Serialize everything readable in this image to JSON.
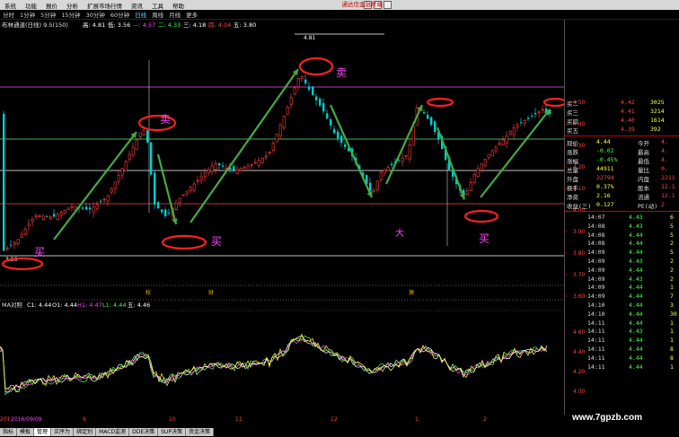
{
  "menubar": {
    "items": [
      "系统",
      "功能",
      "报价",
      "分析",
      "扩展市场行情",
      "资讯",
      "工具",
      "帮助"
    ],
    "brand": "通达信金融终端"
  },
  "periodbar": {
    "items": [
      "分时",
      "1分钟",
      "5分钟",
      "15分钟",
      "30分钟",
      "60分钟",
      "日线",
      "周线",
      "月线",
      "更多"
    ],
    "active": "日线"
  },
  "legend": {
    "main": "布林通道(日线) 9.5(150)",
    "main_vals": [
      {
        "t": "高: 4.81",
        "c": "#ffffff"
      },
      {
        "t": "低: 3.56",
        "c": "#ffffff"
      },
      {
        "t": "—: 4.57",
        "c": "#ff44ff"
      },
      {
        "t": "二: 4.33",
        "c": "#44ff44"
      },
      {
        "t": "三: 4.18",
        "c": "#ffffff"
      },
      {
        "t": "四: 4.04",
        "c": "#ff4444"
      },
      {
        "t": "五: 3.80",
        "c": "#ffffff"
      }
    ],
    "peak_label": "4.81",
    "low_label": "3.56",
    "indicator": "MA对照",
    "ind_vals": [
      {
        "t": "C1: 4.44",
        "c": "#ffffff"
      },
      {
        "t": "O1: 4.44",
        "c": "#ffffff"
      },
      {
        "t": "H1: 4.47",
        "c": "#ff44ff"
      },
      {
        "t": "L1: 4.44",
        "c": "#44ff44"
      },
      {
        "t": "五: 4.46",
        "c": "#ffffff"
      }
    ]
  },
  "annotations": {
    "buy": "买",
    "sell": "卖",
    "markers": [
      "权",
      "财",
      "激"
    ]
  },
  "price_axis": [
    "4.50",
    "4.40",
    "4.30",
    "4.20",
    "4.10",
    "4.00",
    "3.90",
    "3.80",
    "3.70",
    "3.60"
  ],
  "ind_axis": [
    "4.60",
    "4.40",
    "4.20",
    "4.00"
  ],
  "date_axis": [
    "2016/09/09",
    "9",
    "10",
    "11",
    "12",
    "1",
    "2"
  ],
  "date_prefix": "201",
  "quotes": [
    {
      "label": "买二",
      "price": "4.42",
      "vol": "3025"
    },
    {
      "label": "买三",
      "price": "4.41",
      "vol": "3214"
    },
    {
      "label": "买四",
      "price": "4.40",
      "vol": "1614"
    },
    {
      "label": "买五",
      "price": "4.39",
      "vol": "392"
    }
  ],
  "stats": [
    {
      "k": "现价",
      "v": "4.44",
      "k2": "今开",
      "v2": "4."
    },
    {
      "k": "涨跌",
      "v": "-0.02",
      "k2": "最高",
      "v2": "4."
    },
    {
      "k": "涨幅",
      "v": "-0.45%",
      "k2": "最低",
      "v2": "4."
    },
    {
      "k": "总量",
      "v": "44911",
      "k2": "量比",
      "v2": "0."
    },
    {
      "k": "外盘",
      "v": "22794",
      "k2": "内盘",
      "v2": "2211"
    },
    {
      "k": "换手",
      "v": "0.37%",
      "k2": "股本",
      "v2": "12.1"
    },
    {
      "k": "净资",
      "v": "2.16",
      "k2": "流通",
      "v2": "12.1"
    },
    {
      "k": "收益(三)",
      "v": "0.127",
      "k2": "PE(动)",
      "v2": "2"
    }
  ],
  "ticks": [
    {
      "t": "14:07",
      "p": "4.43",
      "v": "6"
    },
    {
      "t": "14:08",
      "p": "4.43",
      "v": "5"
    },
    {
      "t": "14:08",
      "p": "4.44",
      "v": "5"
    },
    {
      "t": "14:08",
      "p": "4.44",
      "v": "2"
    },
    {
      "t": "14:09",
      "p": "4.44",
      "v": "5"
    },
    {
      "t": "14:09",
      "p": "4.43",
      "v": "2"
    },
    {
      "t": "14:09",
      "p": "4.44",
      "v": "2"
    },
    {
      "t": "14:09",
      "p": "4.43",
      "v": "2"
    },
    {
      "t": "14:09",
      "p": "4.44",
      "v": "1"
    },
    {
      "t": "14:09",
      "p": "4.44",
      "v": "7"
    },
    {
      "t": "14:10",
      "p": "4.44",
      "v": "3"
    },
    {
      "t": "14:10",
      "p": "4.44",
      "v": "30"
    },
    {
      "t": "14:11",
      "p": "4.44",
      "v": "1"
    },
    {
      "t": "14:11",
      "p": "4.43",
      "v": "1"
    },
    {
      "t": "14:11",
      "p": "4.44",
      "v": "1"
    },
    {
      "t": "14:11",
      "p": "4.44",
      "v": "8"
    },
    {
      "t": "14:11",
      "p": "4.44",
      "v": "8"
    },
    {
      "t": "14:11",
      "p": "4.44",
      "v": "1"
    }
  ],
  "tabs": [
    "指标",
    "模板",
    "管理",
    "买序为",
    "绑定别",
    "MACD监测",
    "DDE决策",
    "SUP决策",
    "资金决策"
  ],
  "active_tab": "管理",
  "watermark": "www.7gpzb.com",
  "colors": {
    "up": "#ff3b3b",
    "down": "#00d0d0",
    "green": "#44aa44",
    "buy_text": "#ff44ff",
    "red_oval": "#ff2020"
  }
}
